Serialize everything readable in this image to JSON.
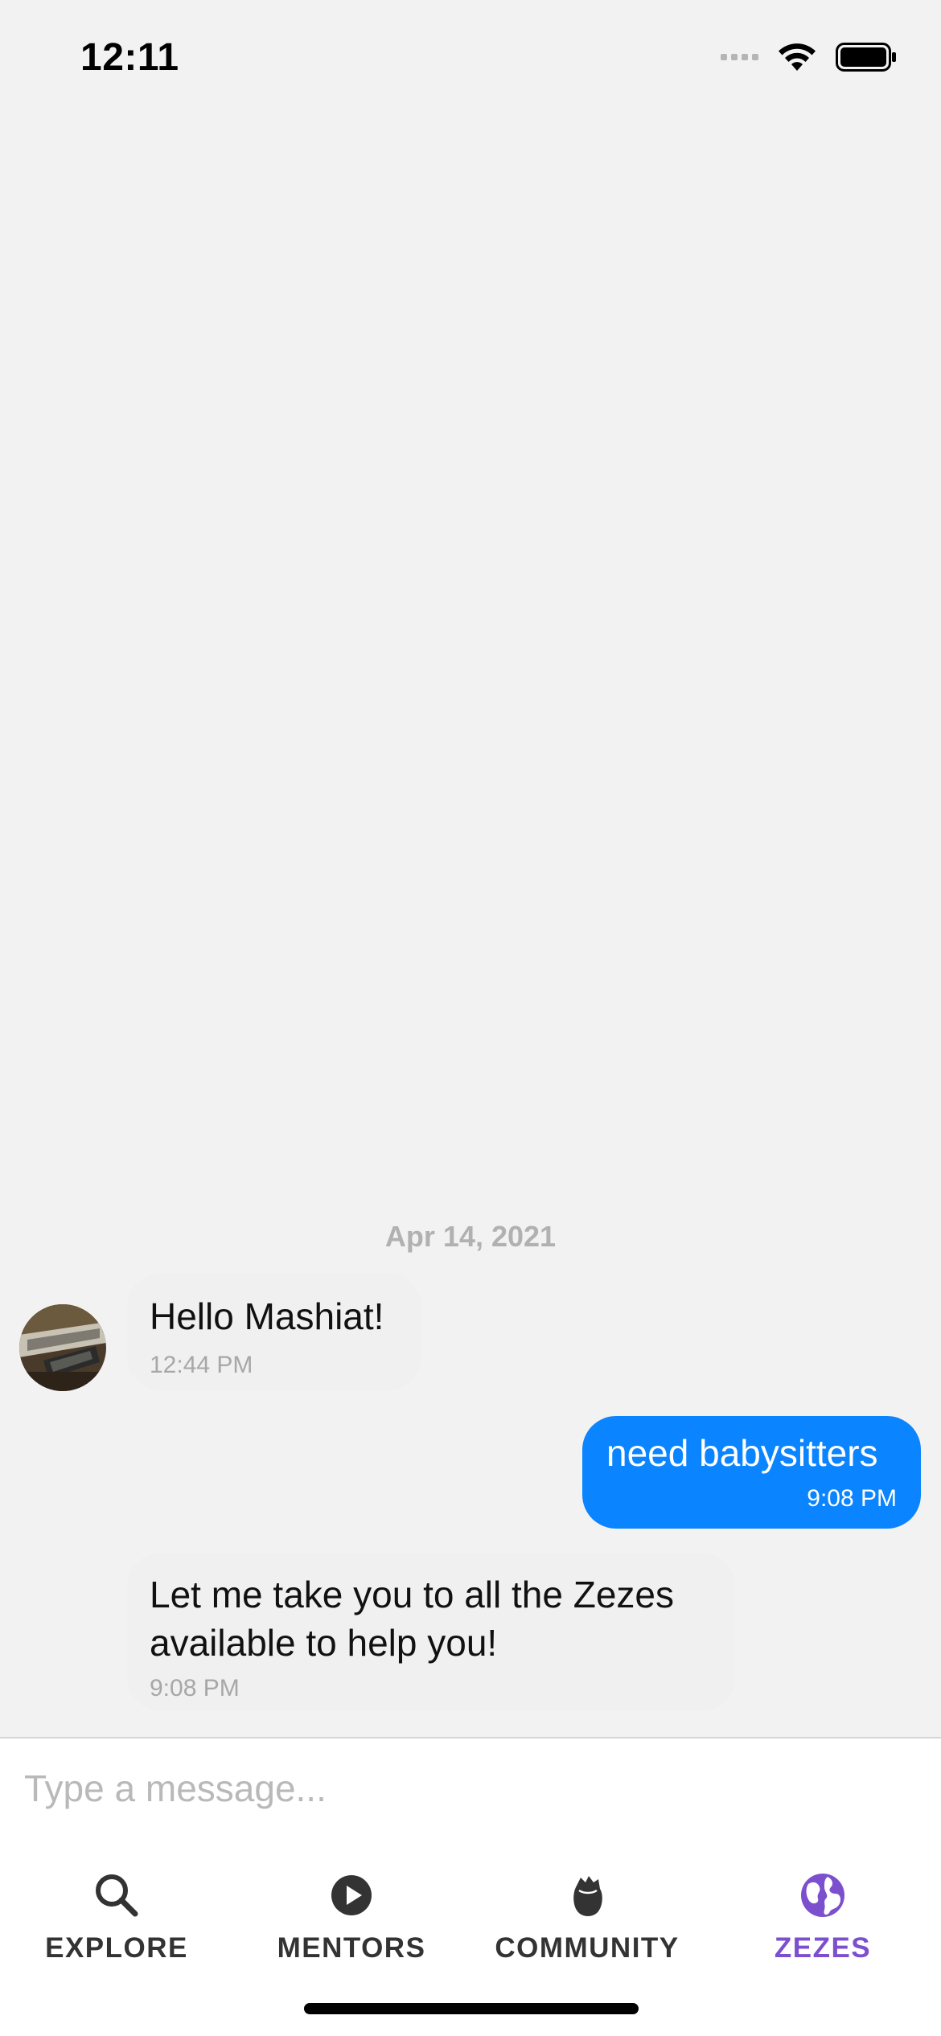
{
  "status_bar": {
    "time": "12:11",
    "icons": [
      "cellular-signal-icon",
      "wifi-icon",
      "battery-icon"
    ]
  },
  "chat": {
    "date_separator": "Apr 14, 2021",
    "messages": [
      {
        "direction": "incoming",
        "text": "Hello Mashiat!",
        "time": "12:44 PM"
      },
      {
        "direction": "outgoing",
        "text": "need babysitters",
        "time": "9:08 PM"
      },
      {
        "direction": "incoming",
        "text": "Let me take you to all the Zezes available to help you!",
        "time": "9:08 PM"
      }
    ]
  },
  "composer": {
    "placeholder": "Type a message...",
    "value": ""
  },
  "tab_bar": {
    "tabs": [
      {
        "label": "EXPLORE",
        "icon": "search-icon",
        "active": false
      },
      {
        "label": "MENTORS",
        "icon": "play-circle-icon",
        "active": false
      },
      {
        "label": "COMMUNITY",
        "icon": "fist-icon",
        "active": false
      },
      {
        "label": "ZEZES",
        "icon": "globe-icon",
        "active": true
      }
    ]
  },
  "colors": {
    "background": "#f2f2f2",
    "outgoing_bubble": "#0a84ff",
    "incoming_bubble": "#f0f0f0",
    "active_tab": "#7b4fce",
    "inactive_tab": "#333333",
    "date_text": "#b1b1b1"
  }
}
